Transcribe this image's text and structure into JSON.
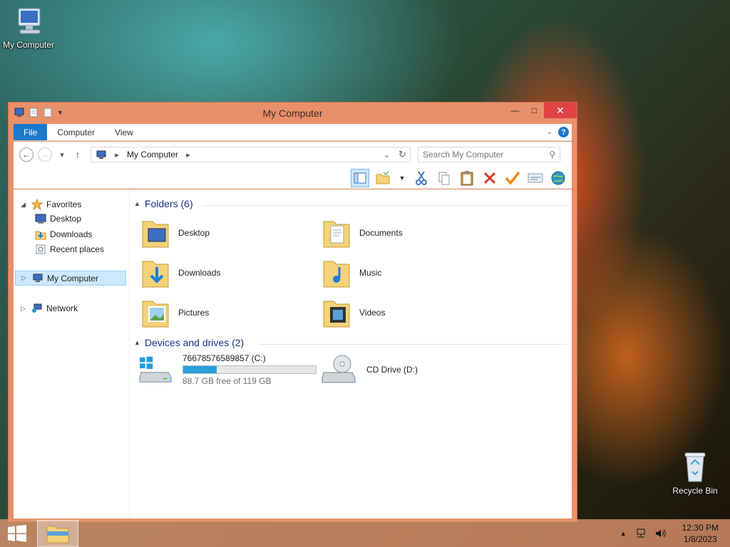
{
  "desktop": {
    "icons": [
      {
        "label": "My Computer"
      },
      {
        "label": "Recycle Bin"
      }
    ]
  },
  "window": {
    "title": "My Computer",
    "ribbon_tabs": [
      "File",
      "Computer",
      "View"
    ],
    "address": {
      "location": "My Computer"
    },
    "search_placeholder": "Search My Computer"
  },
  "nav_pane": {
    "favorites": "Favorites",
    "favorite_items": [
      "Desktop",
      "Downloads",
      "Recent places"
    ],
    "computer": "My Computer",
    "network": "Network"
  },
  "folders_group": {
    "header": "Folders (6)",
    "items": [
      "Desktop",
      "Documents",
      "Downloads",
      "Music",
      "Pictures",
      "Videos"
    ]
  },
  "drives_group": {
    "header": "Devices and drives (2)",
    "drives": [
      {
        "name": "76678576589857 (C:)",
        "free_text": "88.7 GB free of 119 GB",
        "used_fraction": 0.255
      },
      {
        "name": "CD Drive (D:)"
      }
    ]
  },
  "taskbar": {
    "time": "12:30 PM",
    "date": "1/8/2023"
  },
  "colors": {
    "window_frame": "#e9906a",
    "file_tab": "#1979ca",
    "close_button": "#e04343",
    "drive_bar": "#26a0da"
  }
}
